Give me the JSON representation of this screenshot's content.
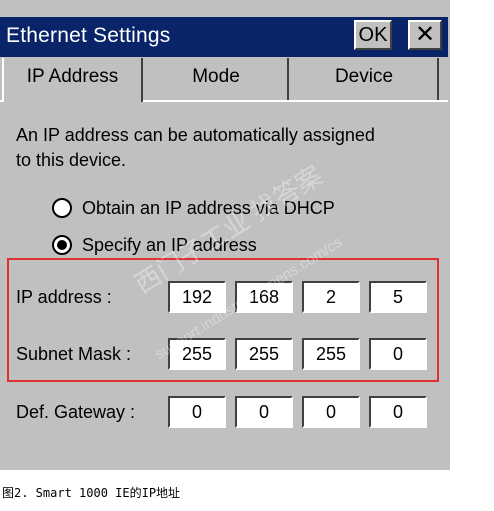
{
  "window": {
    "title": "Ethernet Settings",
    "ok_label": "OK",
    "close_glyph": "✕"
  },
  "tabs": [
    {
      "label": "IP Address",
      "active": true
    },
    {
      "label": "Mode",
      "active": false
    },
    {
      "label": "Device",
      "active": false
    }
  ],
  "description": "An IP address can be automatically assigned to this device.",
  "radios": {
    "dhcp": {
      "label": "Obtain an IP address via DHCP",
      "selected": false
    },
    "specify": {
      "label": "Specify an IP address",
      "selected": true
    }
  },
  "fields": {
    "ip_address": {
      "label": "IP address :",
      "octets": [
        "192",
        "168",
        "2",
        "5"
      ]
    },
    "subnet_mask": {
      "label": "Subnet Mask :",
      "octets": [
        "255",
        "255",
        "255",
        "0"
      ]
    },
    "gateway": {
      "label": "Def. Gateway :",
      "octets": [
        "0",
        "0",
        "0",
        "0"
      ]
    }
  },
  "watermark": {
    "line1": "西门子工业 找答案",
    "line2": "support.industry.siemens.com/cs"
  },
  "caption": "图2. Smart 1000 IE的IP地址",
  "colors": {
    "titlebar": "#0a246a",
    "window_bg": "#c0c0c0",
    "highlight_box": "#e03030"
  }
}
